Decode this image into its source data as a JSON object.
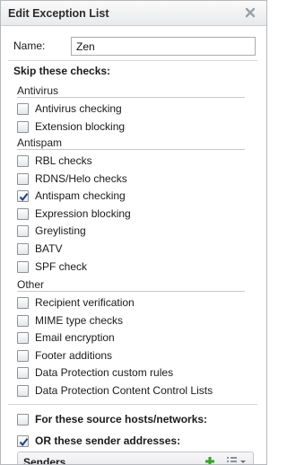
{
  "dialog": {
    "title": "Edit Exception List",
    "close_icon": "close-icon"
  },
  "name_field": {
    "label": "Name:",
    "value": "Zen"
  },
  "skip_section": {
    "heading": "Skip these checks:",
    "groups": [
      {
        "title": "Antivirus",
        "items": [
          {
            "label": "Antivirus checking",
            "checked": false
          },
          {
            "label": "Extension blocking",
            "checked": false
          }
        ]
      },
      {
        "title": "Antispam",
        "items": [
          {
            "label": "RBL checks",
            "checked": false
          },
          {
            "label": "RDNS/Helo checks",
            "checked": false
          },
          {
            "label": "Antispam checking",
            "checked": true
          },
          {
            "label": "Expression blocking",
            "checked": false
          },
          {
            "label": "Greylisting",
            "checked": false
          },
          {
            "label": "BATV",
            "checked": false
          },
          {
            "label": "SPF check",
            "checked": false
          }
        ]
      },
      {
        "title": "Other",
        "items": [
          {
            "label": "Recipient verification",
            "checked": false
          },
          {
            "label": "MIME type checks",
            "checked": false
          },
          {
            "label": "Email encryption",
            "checked": false
          },
          {
            "label": "Footer additions",
            "checked": false
          },
          {
            "label": "Data Protection custom rules",
            "checked": false
          },
          {
            "label": "Data Protection Content Control Lists",
            "checked": false
          }
        ]
      }
    ]
  },
  "source_hosts": {
    "label": "For these source hosts/networks:",
    "checked": false
  },
  "sender_addresses": {
    "label": "OR these sender addresses:",
    "checked": true
  },
  "senders_panel": {
    "header": "Senders",
    "add_icon": "plus-icon",
    "menu_icon": "list-menu-icon"
  },
  "colors": {
    "add_icon": "#3aa02a",
    "check_mark": "#1f3f7a"
  }
}
